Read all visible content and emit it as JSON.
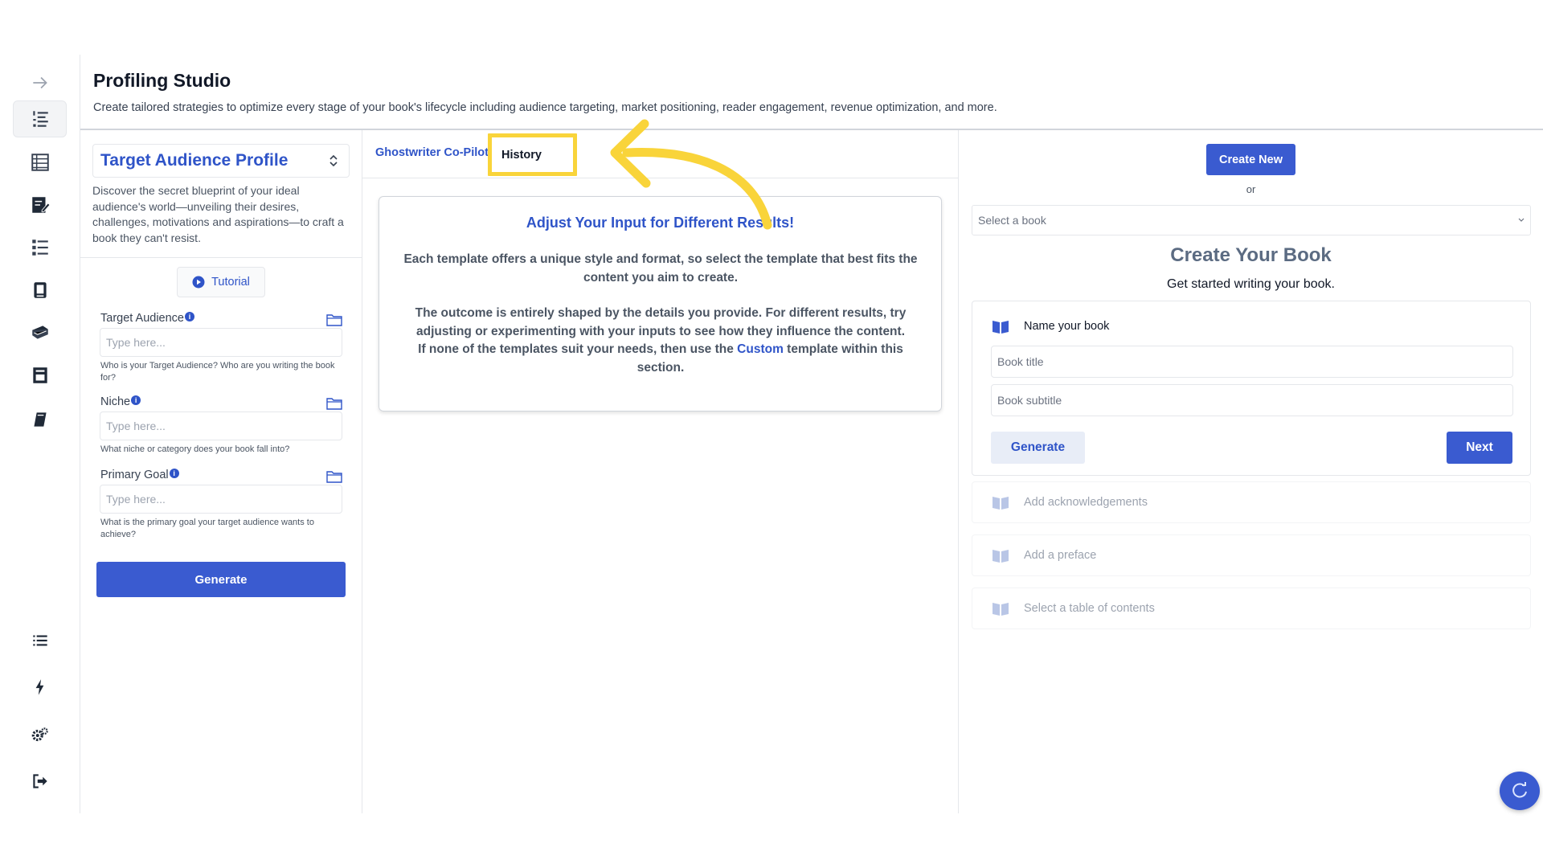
{
  "header": {
    "title": "Profiling Studio",
    "description": "Create tailored strategies to optimize every stage of your book's lifecycle including audience targeting, market positioning, reader engagement, revenue optimization, and more."
  },
  "rail": {
    "icons": [
      "expand-arrow-icon",
      "numbered-list-icon",
      "table-icon",
      "edit-document-icon",
      "bullet-list-icon",
      "book-stack-icon",
      "books-icon",
      "storefront-icon",
      "notebook-icon",
      "list-icon",
      "lightning-icon",
      "settings-gears-icon",
      "logout-icon"
    ]
  },
  "left_panel": {
    "profile_select": "Target Audience Profile",
    "description": "Discover the secret blueprint of your ideal audience's world—unveiling their desires, challenges, motivations and aspirations—to craft a book they can't resist.",
    "tutorial_label": "Tutorial",
    "fields": [
      {
        "label": "Target Audience",
        "placeholder": "Type here...",
        "help": "Who is your Target Audience? Who are you writing the book for?"
      },
      {
        "label": "Niche",
        "placeholder": "Type here...",
        "help": "What niche or category does your book fall into?"
      },
      {
        "label": "Primary Goal",
        "placeholder": "Type here...",
        "help": "What is the primary goal your target audience wants to achieve?"
      }
    ],
    "generate_label": "Generate"
  },
  "middle_panel": {
    "tabs": [
      {
        "label": "Ghostwriter Co-Pilot"
      },
      {
        "label": "History"
      }
    ],
    "card": {
      "title": "Adjust Your Input for Different Results!",
      "p1": "Each template offers a unique style and format, so select the template that best fits the content you aim to create.",
      "p2": "The outcome is entirely shaped by the details you provide. For different results, try adjusting or experimenting with your inputs to see how they influence the content.",
      "p3_before": "If none of the templates suit your needs, then use the ",
      "p3_link": "Custom",
      "p3_after": " template within this section."
    }
  },
  "right_panel": {
    "create_new_label": "Create New",
    "or_text": "or",
    "book_select_placeholder": "Select a book",
    "title": "Create Your Book",
    "subtitle": "Get started writing your book.",
    "step_name": {
      "label": "Name your book",
      "title_placeholder": "Book title",
      "subtitle_placeholder": "Book subtitle",
      "generate_label": "Generate",
      "next_label": "Next"
    },
    "steps": [
      "Add acknowledgements",
      "Add a preface",
      "Select a table of contents"
    ]
  },
  "colors": {
    "accent": "#3a5bd0",
    "highlight": "#f9d43a"
  }
}
